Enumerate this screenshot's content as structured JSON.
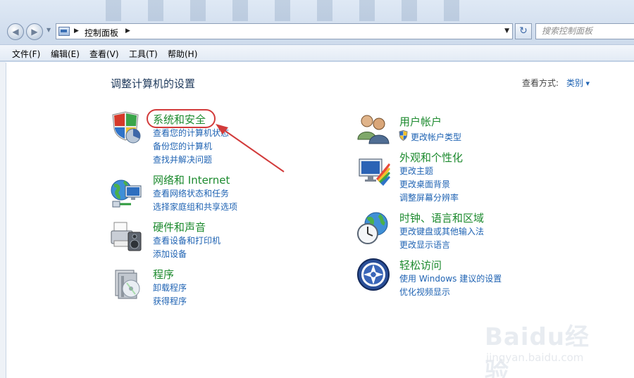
{
  "window": {
    "address": "控制面板",
    "search_placeholder": "搜索控制面板"
  },
  "menu": [
    "文件(F)",
    "编辑(E)",
    "查看(V)",
    "工具(T)",
    "帮助(H)"
  ],
  "page": {
    "title": "调整计算机的设置",
    "view_by_label": "查看方式:",
    "view_by_value": "类别"
  },
  "categories": {
    "system_security": {
      "title": "系统和安全",
      "links": [
        "查看您的计算机状态",
        "备份您的计算机",
        "查找并解决问题"
      ]
    },
    "network": {
      "title": "网络和 Internet",
      "links": [
        "查看网络状态和任务",
        "选择家庭组和共享选项"
      ]
    },
    "hardware": {
      "title": "硬件和声音",
      "links": [
        "查看设备和打印机",
        "添加设备"
      ]
    },
    "programs": {
      "title": "程序",
      "links": [
        "卸载程序",
        "获得程序"
      ]
    },
    "user_accounts": {
      "title": "用户帐户",
      "links": [
        "更改帐户类型"
      ]
    },
    "appearance": {
      "title": "外观和个性化",
      "links": [
        "更改主题",
        "更改桌面背景",
        "调整屏幕分辨率"
      ]
    },
    "clock": {
      "title": "时钟、语言和区域",
      "links": [
        "更改键盘或其他输入法",
        "更改显示语言"
      ]
    },
    "ease": {
      "title": "轻松访问",
      "links": [
        "使用 Windows 建议的设置",
        "优化视频显示"
      ]
    }
  },
  "icons": {
    "back": "back-arrow-icon",
    "forward": "forward-arrow-icon",
    "refresh": "refresh-icon",
    "control_panel": "control-panel-icon"
  },
  "colors": {
    "category_title": "#1c8a2e",
    "link": "#1f63b3",
    "annotation": "#d23b3b"
  },
  "watermark": {
    "brand": "Baidu经验",
    "url": "jingyan.baidu.com"
  }
}
